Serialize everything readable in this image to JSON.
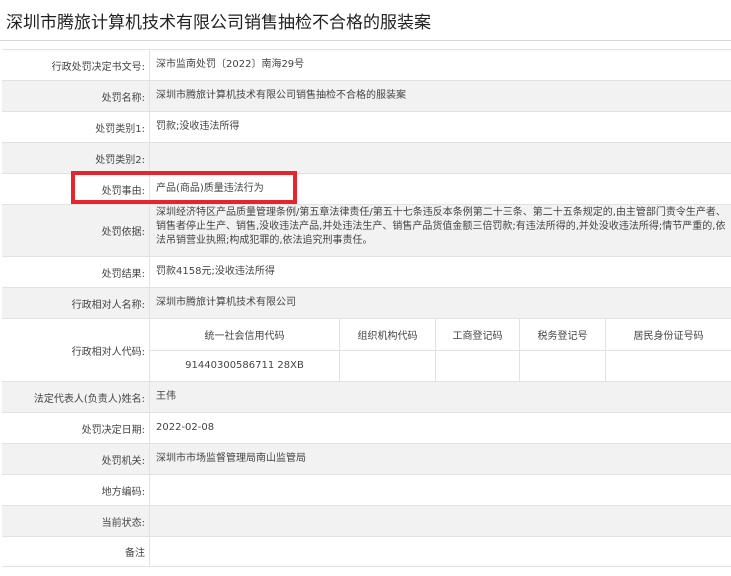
{
  "title": "深圳市腾旅计算机技术有限公司销售抽检不合格的服装案",
  "rows": [
    {
      "label": "行政处罚决定书文号:",
      "value": "深市监南处罚〔2022〕南海29号"
    },
    {
      "label": "处罚名称:",
      "value": "深圳市腾旅计算机技术有限公司销售抽检不合格的服装案"
    },
    {
      "label": "处罚类别1:",
      "value": "罚款;没收违法所得"
    },
    {
      "label": "处罚类别2:",
      "value": ""
    },
    {
      "label": "处罚事由:",
      "value": "产品(商品)质量违法行为"
    },
    {
      "label": "处罚依据:",
      "value": "深圳经济特区产品质量管理条例/第五章法律责任/第五十七条违反本条例第二十三条、第二十五条规定的,由主管部门责令生产者、销售者停止生产、销售,没收违法产品,并处违法生产、销售产品货值金额三倍罚款;有违法所得的,并处没收违法所得;情节严重的,依法吊销营业执照;构成犯罪的,依法追究刑事责任。"
    },
    {
      "label": "处罚结果:",
      "value": "罚款4158元;没收违法所得"
    },
    {
      "label": "行政相对人名称:",
      "value": "深圳市腾旅计算机技术有限公司"
    },
    {
      "label": "行政相对人代码:",
      "codes": {
        "headers": [
          "统一社会信用代码",
          "组织机构代码",
          "工商登记码",
          "税务登记号",
          "居民身份证号码"
        ],
        "values": [
          "91440300586711 28XB",
          "",
          "",
          "",
          ""
        ]
      }
    },
    {
      "label": "法定代表人(负责人)姓名:",
      "value": "王伟"
    },
    {
      "label": "处罚决定日期:",
      "value": "2022-02-08"
    },
    {
      "label": "处罚机关:",
      "value": "深圳市市场监督管理局南山监管局"
    },
    {
      "label": "地方编码:",
      "value": ""
    },
    {
      "label": "当前状态:",
      "value": ""
    },
    {
      "label": "备注",
      "value": ""
    }
  ],
  "colors": {
    "highlight": "#e3262c",
    "shade": "#f2f2f2",
    "border": "#e2e2e2"
  }
}
